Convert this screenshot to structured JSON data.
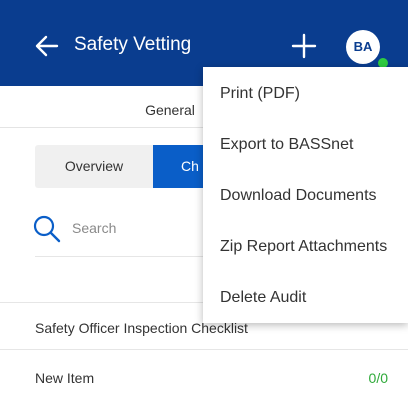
{
  "appbar": {
    "title": "Safety Vetting",
    "avatar_initials": "BA"
  },
  "tabs": {
    "general": "General"
  },
  "segmented": {
    "overview": "Overview",
    "active_partial": "Ch"
  },
  "search": {
    "placeholder": "Search"
  },
  "list": {
    "section_title": "Safety Officer Inspection Checklist",
    "items": [
      {
        "label": "New Item",
        "count": "0/0"
      }
    ]
  },
  "menu": {
    "items": [
      {
        "label": "Print (PDF)"
      },
      {
        "label": "Export to BASSnet"
      },
      {
        "label": "Download Documents"
      },
      {
        "label": "Zip Report Attachments"
      },
      {
        "label": "Delete Audit"
      }
    ]
  },
  "colors": {
    "appbar": "#0a3d8f",
    "segment_active": "#0a5ec8",
    "count_green": "#2faa3a",
    "status_dot": "#2ecc40"
  },
  "icons": {
    "back": "arrow-left-icon",
    "add": "plus-icon",
    "search": "search-icon"
  }
}
